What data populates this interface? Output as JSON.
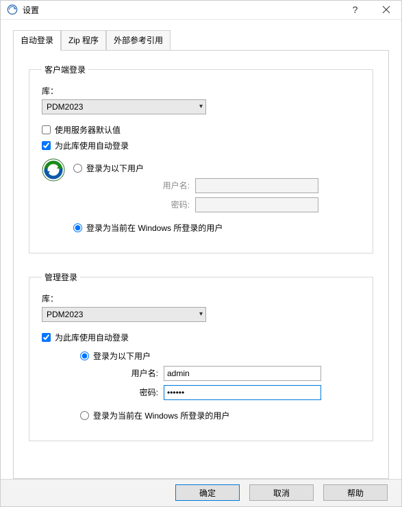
{
  "window": {
    "title": "设置"
  },
  "tabs": [
    {
      "label": "自动登录",
      "active": true
    },
    {
      "label": "Zip 程序",
      "active": false
    },
    {
      "label": "外部参考引用",
      "active": false
    }
  ],
  "client_login": {
    "legend": "客户端登录",
    "vault_label": "库：",
    "vault_value": "PDM2023",
    "use_server_default_label": "使用服务器默认值",
    "use_server_default_checked": false,
    "use_auto_login_label": "为此库使用自动登录",
    "use_auto_login_checked": true,
    "login_as_user_label": "登录为以下用户",
    "login_as_user_selected": false,
    "username_label": "用户名:",
    "username_value": "",
    "password_label": "密码:",
    "password_value": "",
    "login_as_windows_label": "登录为当前在 Windows 所登录的用户",
    "login_as_windows_selected": true
  },
  "admin_login": {
    "legend": "管理登录",
    "vault_label": "库：",
    "vault_value": "PDM2023",
    "use_auto_login_label": "为此库使用自动登录",
    "use_auto_login_checked": true,
    "login_as_user_label": "登录为以下用户",
    "login_as_user_selected": true,
    "username_label": "用户名:",
    "username_value": "admin",
    "password_label": "密码:",
    "password_value": "••••••",
    "login_as_windows_label": "登录为当前在 Windows 所登录的用户",
    "login_as_windows_selected": false
  },
  "buttons": {
    "ok": "确定",
    "cancel": "取消",
    "help": "帮助"
  }
}
